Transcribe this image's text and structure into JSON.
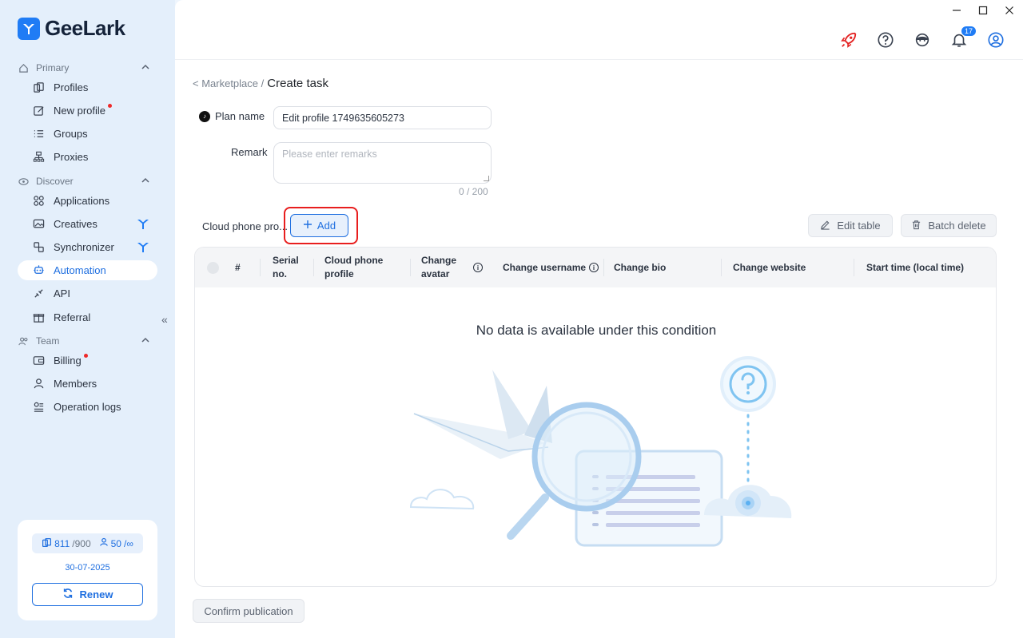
{
  "app": {
    "name": "GeeLark"
  },
  "sidebar": {
    "sections": [
      {
        "label": "Primary"
      },
      {
        "label": "Discover"
      },
      {
        "label": "Team"
      }
    ],
    "items": [
      {
        "label": "Profiles"
      },
      {
        "label": "New profile"
      },
      {
        "label": "Groups"
      },
      {
        "label": "Proxies"
      },
      {
        "label": "Applications"
      },
      {
        "label": "Creatives"
      },
      {
        "label": "Synchronizer"
      },
      {
        "label": "Automation"
      },
      {
        "label": "API"
      },
      {
        "label": "Referral"
      },
      {
        "label": "Billing"
      },
      {
        "label": "Members"
      },
      {
        "label": "Operation logs"
      }
    ],
    "plan": {
      "profiles_used": "811",
      "profiles_total": "/900",
      "members_used": "50",
      "members_total": "/∞",
      "expire_date": "30-07-2025",
      "renew_label": "Renew"
    }
  },
  "topbar": {
    "notification_count": "17"
  },
  "breadcrumb": {
    "parent": "< Marketplace /",
    "current": "Create task"
  },
  "form": {
    "plan_name_label": "Plan name",
    "plan_name_value": "Edit profile 1749635605273",
    "remark_label": "Remark",
    "remark_placeholder": "Please enter remarks",
    "remark_counter": "0 / 200",
    "profiles_label": "Cloud phone pro...",
    "add_label": "Add",
    "edit_table_label": "Edit table",
    "batch_delete_label": "Batch delete"
  },
  "table": {
    "columns": [
      "#",
      "Serial no.",
      "Cloud phone profile",
      "Change avatar",
      "Change username",
      "Change bio",
      "Change website",
      "Start time (local time)"
    ],
    "empty_text": "No data is available under this condition"
  },
  "footer": {
    "confirm_label": "Confirm publication"
  },
  "colors": {
    "accent": "#1f6fe0",
    "highlight": "#e81e1e",
    "sidebar_bg": "#e4effb"
  }
}
